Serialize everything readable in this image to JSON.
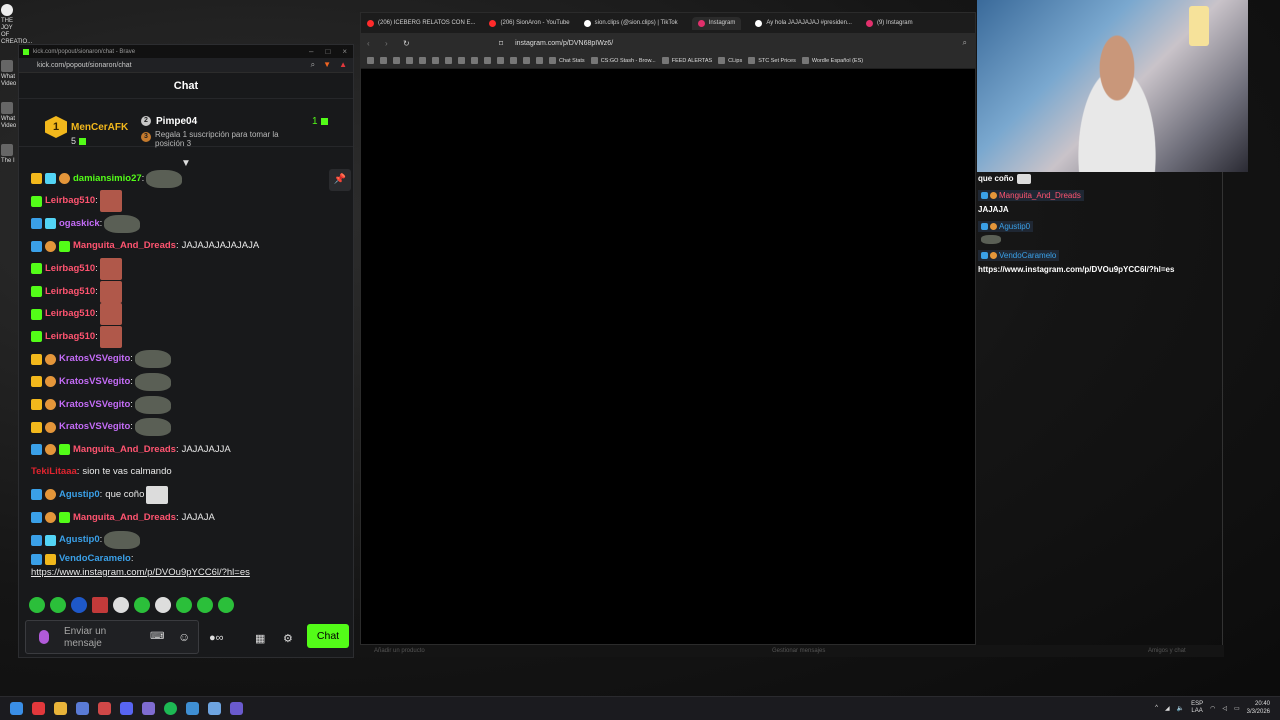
{
  "desktop": {
    "icons": [
      {
        "label": "THE JOY OF CREATIO..."
      },
      {
        "label": "What Video"
      },
      {
        "label": "What Video"
      },
      {
        "label": "The I"
      }
    ]
  },
  "kick_window": {
    "title": "kick.com/popout/sionaron/chat - Brave",
    "url": "kick.com/popout/sionaron/chat",
    "header": "Chat",
    "leaderboard": {
      "first": {
        "rank": "1",
        "name": "MenCerAFK",
        "count": "5"
      },
      "second": {
        "rank": "2",
        "name": "Pimpe04",
        "count": "1"
      },
      "third": {
        "rank": "3",
        "prompt": "Regala 1 suscripción para tomar la posición 3"
      }
    },
    "messages": [
      {
        "user": "damiansimio27",
        "color": "#53fc18",
        "badges": [
          "crown",
          "vip",
          "og"
        ],
        "text": "",
        "emote": "rock"
      },
      {
        "user": "Leirbag510",
        "color": "#ff5470",
        "badges": [
          "sub"
        ],
        "text": "",
        "emote": "face"
      },
      {
        "user": "ogaskick",
        "color": "#c46cf7",
        "badges": [
          "mod",
          "vip"
        ],
        "text": "",
        "emote": "rock"
      },
      {
        "user": "Manguita_And_Dreads",
        "color": "#ff5470",
        "badges": [
          "mod",
          "og",
          "sub"
        ],
        "text": "JAJAJAJAJAJAJA",
        "emote": ""
      },
      {
        "user": "Leirbag510",
        "color": "#ff5470",
        "badges": [
          "sub"
        ],
        "text": "",
        "emote": "face"
      },
      {
        "user": "Leirbag510",
        "color": "#ff5470",
        "badges": [
          "sub"
        ],
        "text": "",
        "emote": "face"
      },
      {
        "user": "Leirbag510",
        "color": "#ff5470",
        "badges": [
          "sub"
        ],
        "text": "",
        "emote": "face"
      },
      {
        "user": "Leirbag510",
        "color": "#ff5470",
        "badges": [
          "sub"
        ],
        "text": "",
        "emote": "face"
      },
      {
        "user": "KratosVSVegito",
        "color": "#c46cf7",
        "badges": [
          "crown",
          "og"
        ],
        "text": "",
        "emote": "rock"
      },
      {
        "user": "KratosVSVegito",
        "color": "#c46cf7",
        "badges": [
          "crown",
          "og"
        ],
        "text": "",
        "emote": "rock"
      },
      {
        "user": "KratosVSVegito",
        "color": "#c46cf7",
        "badges": [
          "crown",
          "og"
        ],
        "text": "",
        "emote": "rock"
      },
      {
        "user": "KratosVSVegito",
        "color": "#c46cf7",
        "badges": [
          "crown",
          "og"
        ],
        "text": "",
        "emote": "rock"
      },
      {
        "user": "Manguita_And_Dreads",
        "color": "#ff5470",
        "badges": [
          "mod",
          "og",
          "sub"
        ],
        "text": "JAJAJAJJA",
        "emote": ""
      },
      {
        "user": "TekiLitaaa",
        "color": "#e0242f",
        "badges": [],
        "text": "sion te vas calmando",
        "emote": ""
      },
      {
        "user": "Agustip0",
        "color": "#3aa0e8",
        "badges": [
          "mod",
          "og"
        ],
        "text": "que coño",
        "emote": "small"
      },
      {
        "user": "Manguita_And_Dreads",
        "color": "#ff5470",
        "badges": [
          "mod",
          "og",
          "sub"
        ],
        "text": "JAJAJA",
        "emote": ""
      },
      {
        "user": "Agustip0",
        "color": "#3aa0e8",
        "badges": [
          "mod",
          "vip"
        ],
        "text": "",
        "emote": "rock"
      },
      {
        "user": "VendoCaramelo",
        "color": "#3aa0e8",
        "badges": [
          "mod",
          "crown"
        ],
        "text": "",
        "emote": ""
      }
    ],
    "last_link": "https://www.instagram.com/p/DVOu9pYCC6l/?hl=es",
    "input_placeholder": "Enviar un mensaje",
    "send_label": "Chat"
  },
  "browser": {
    "tabs": [
      {
        "label": "(206) ICEBERG RELATOS CON E...",
        "color": "#ff2b2b"
      },
      {
        "label": "(206) SionAron - YouTube",
        "color": "#ff2b2b"
      },
      {
        "label": "sion.clips (@sion.clips) | TikTok",
        "color": "#ffffff"
      },
      {
        "label": "Instagram",
        "color": "#e1306c",
        "active": true
      },
      {
        "label": "Ay hola JAJAJAJAJ #presiden...",
        "color": "#ffffff"
      },
      {
        "label": "(9) Instagram",
        "color": "#e1306c"
      }
    ],
    "url": "instagram.com/p/DVN68pIWz6/",
    "bookmarks": [
      {
        "label": "Chat Stats"
      },
      {
        "label": "CS:GO Stash - Brow..."
      },
      {
        "label": "FEED ALERTAS"
      },
      {
        "label": "CLips"
      },
      {
        "label": "STC Set Prices"
      },
      {
        "label": "Wordle Español (ES)"
      }
    ],
    "footer_left": "Añadir un producto",
    "footer_mid": "Gestionar mensajes",
    "footer_right": "Amigos y chat"
  },
  "overlay_chat": {
    "lines": [
      {
        "type": "text",
        "text": "que coño"
      },
      {
        "type": "user",
        "user": "Manguita_And_Dreads",
        "color": "#ff5470"
      },
      {
        "type": "text",
        "text": "JAJAJA"
      },
      {
        "type": "user",
        "user": "Agustip0",
        "color": "#3aa0e8"
      },
      {
        "type": "emote"
      },
      {
        "type": "user",
        "user": "VendoCaramelo",
        "color": "#3aa0e8"
      },
      {
        "type": "text",
        "text": "https://www.instagram.com/p/DVOu9pYCC6l/?hl=es"
      }
    ]
  },
  "taskbar": {
    "lang_top": "ESP",
    "lang_bottom": "LAA",
    "time": "20:40",
    "date": "3/3/2026"
  }
}
